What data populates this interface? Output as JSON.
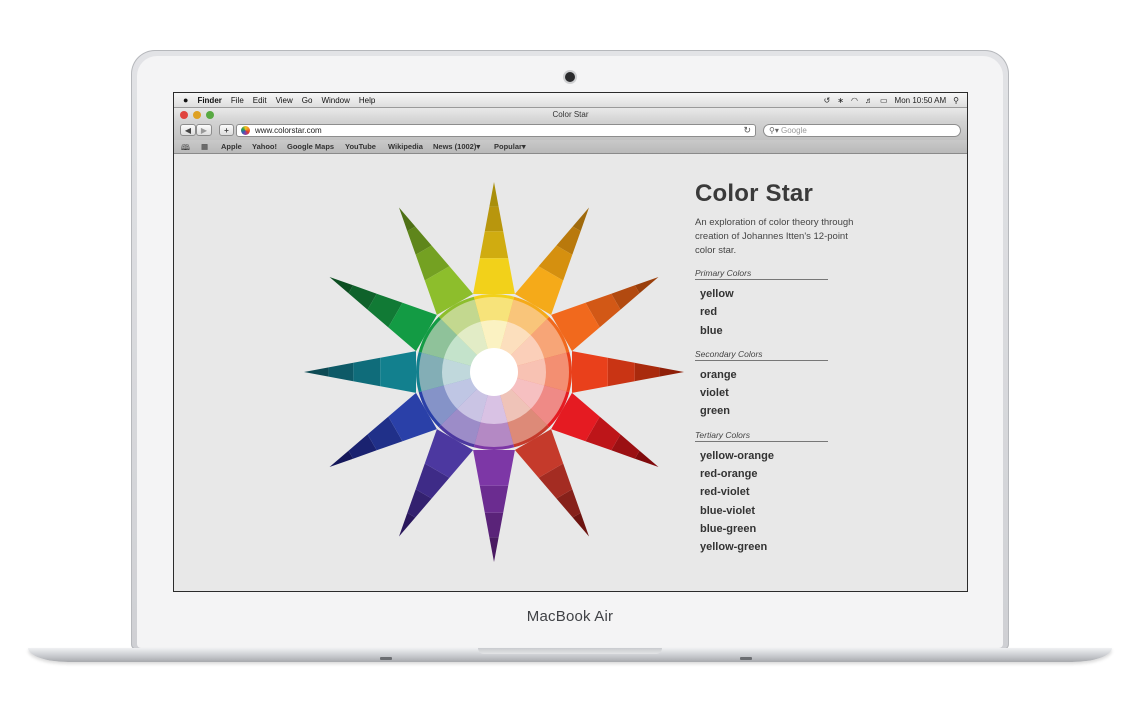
{
  "device": {
    "brand": "MacBook Air"
  },
  "menubar": {
    "apple_icon": "",
    "app_name": "Finder",
    "items": [
      "File",
      "Edit",
      "View",
      "Go",
      "Window",
      "Help"
    ],
    "status_icons": [
      "time-machine-icon",
      "bluetooth-icon",
      "wifi-icon",
      "volume-icon",
      "battery-icon"
    ],
    "clock": "Mon 10:50 AM",
    "spotlight_icon": "search-icon"
  },
  "browser": {
    "window_title": "Color Star",
    "back_label": "◀",
    "forward_label": "▶",
    "add_label": "+",
    "url": "www.colorstar.com",
    "search_placeholder": "Google",
    "bookmarks": [
      "Apple",
      "Yahoo!",
      "Google Maps",
      "YouTube",
      "Wikipedia",
      "News (1002)",
      "Popular"
    ]
  },
  "page": {
    "title": "Color Star",
    "intro": "An exploration of color theory through creation of Johannes Itten's 12-point color star.",
    "sections": [
      {
        "heading": "Primary Colors",
        "items": [
          "yellow",
          "red",
          "blue"
        ]
      },
      {
        "heading": "Secondary Colors",
        "items": [
          "orange",
          "violet",
          "green"
        ]
      },
      {
        "heading": "Tertiary Colors",
        "items": [
          "yellow-orange",
          "red-orange",
          "red-violet",
          "blue-violet",
          "blue-green",
          "yellow-green"
        ]
      }
    ]
  },
  "color_star": {
    "points": [
      {
        "name": "yellow",
        "tip": "#a98f0b",
        "shades": [
          "#b8960d",
          "#d0ac10",
          "#f2d11a"
        ]
      },
      {
        "name": "yellow-orange",
        "tip": "#a06a0c",
        "shades": [
          "#b9790c",
          "#d5900f",
          "#f5aa19"
        ]
      },
      {
        "name": "orange",
        "tip": "#9a3f0b",
        "shades": [
          "#b24a10",
          "#d25816",
          "#f1691d"
        ]
      },
      {
        "name": "red-orange",
        "tip": "#8e1f08",
        "shades": [
          "#a92a0d",
          "#c93414",
          "#e9401b"
        ]
      },
      {
        "name": "red",
        "tip": "#800a0c",
        "shades": [
          "#9b1013",
          "#bd1519",
          "#e51b22"
        ]
      },
      {
        "name": "red-violet",
        "tip": "#6d1410",
        "shades": [
          "#86211a",
          "#a42c22",
          "#c53a2b"
        ]
      },
      {
        "name": "violet",
        "tip": "#4a1a62",
        "shades": [
          "#5a2379",
          "#6b2c90",
          "#7d37a6"
        ]
      },
      {
        "name": "blue-violet",
        "tip": "#2a175c",
        "shades": [
          "#33216f",
          "#3e2b87",
          "#4c38a0"
        ]
      },
      {
        "name": "blue",
        "tip": "#14175a",
        "shades": [
          "#1a2270",
          "#203089",
          "#2a40a8"
        ]
      },
      {
        "name": "blue-green",
        "tip": "#0d4a54",
        "shades": [
          "#0e5a67",
          "#0f6c7a",
          "#12808e"
        ]
      },
      {
        "name": "green",
        "tip": "#0d4e22",
        "shades": [
          "#0f622b",
          "#117a35",
          "#139b44"
        ]
      },
      {
        "name": "yellow-green",
        "tip": "#4e7016",
        "shades": [
          "#5f861b",
          "#74a122",
          "#8dbe2c"
        ]
      }
    ],
    "ring_tints": [
      "#f7e37a",
      "#f9c57a",
      "#f7a577",
      "#f38f72",
      "#ef8a86",
      "#dd8a78",
      "#b489c4",
      "#9c8cc8",
      "#8593c8",
      "#83aeb6",
      "#8fc29a",
      "#c3d88f"
    ],
    "inner_tints": [
      "#fbf2c2",
      "#fcdfbd",
      "#fbcfb9",
      "#f8c2b3",
      "#f6c0c1",
      "#efc3b8",
      "#d9c2e4",
      "#cac4e4",
      "#bfc6e4",
      "#c0d8dc",
      "#c4e3cb",
      "#e2ecc6"
    ]
  }
}
